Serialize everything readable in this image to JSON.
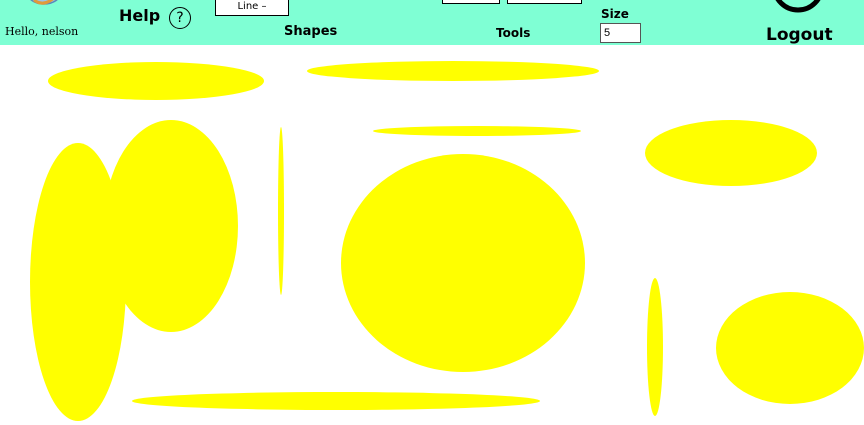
{
  "header": {
    "greeting": "Hello, nelson",
    "help_label": "Help",
    "help_icon_glyph": "?",
    "line_style_value": "Line –",
    "shapes_label": "Shapes",
    "tools_label": "Tools",
    "size_label": "Size",
    "size_value": "5",
    "logout_label": "Logout",
    "background_color": "#7fffd4"
  },
  "icons": {
    "avatar": "avatar-icon",
    "help": "question-circle-icon",
    "logout": "power-icon"
  },
  "canvas": {
    "background_color": "#ffffff",
    "shape_type": "ellipse",
    "fill_color": "#ffff00",
    "shape_count": 13
  }
}
